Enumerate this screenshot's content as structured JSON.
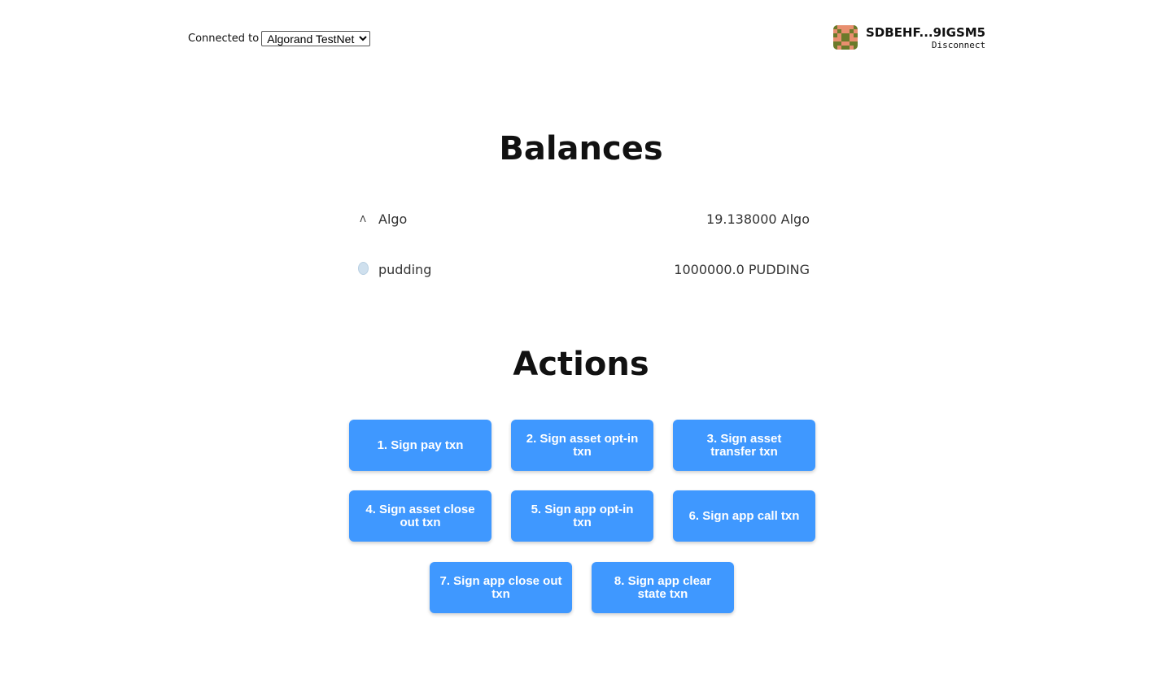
{
  "header": {
    "connected_label": "Connected to",
    "network": "Algorand TestNet",
    "address": "SDBEHF...9IGSM5",
    "disconnect": "Disconnect"
  },
  "balances": {
    "title": "Balances",
    "items": [
      {
        "icon": "algo-icon",
        "name": "Algo",
        "amount": "19.138000 Algo"
      },
      {
        "icon": "coin-icon",
        "name": "pudding",
        "amount": "1000000.0 PUDDING"
      }
    ]
  },
  "actions": {
    "title": "Actions",
    "buttons": [
      "1. Sign pay txn",
      "2. Sign asset opt-in txn",
      "3. Sign asset transfer txn",
      "4. Sign asset close out txn",
      "5. Sign app opt-in txn",
      "6. Sign app call txn",
      "7. Sign app close out txn",
      "8. Sign app clear state txn"
    ]
  },
  "colors": {
    "button": "#3f98ff",
    "avatar_bg": "#6b7a2a",
    "avatar_fg": "#e88f6f"
  }
}
